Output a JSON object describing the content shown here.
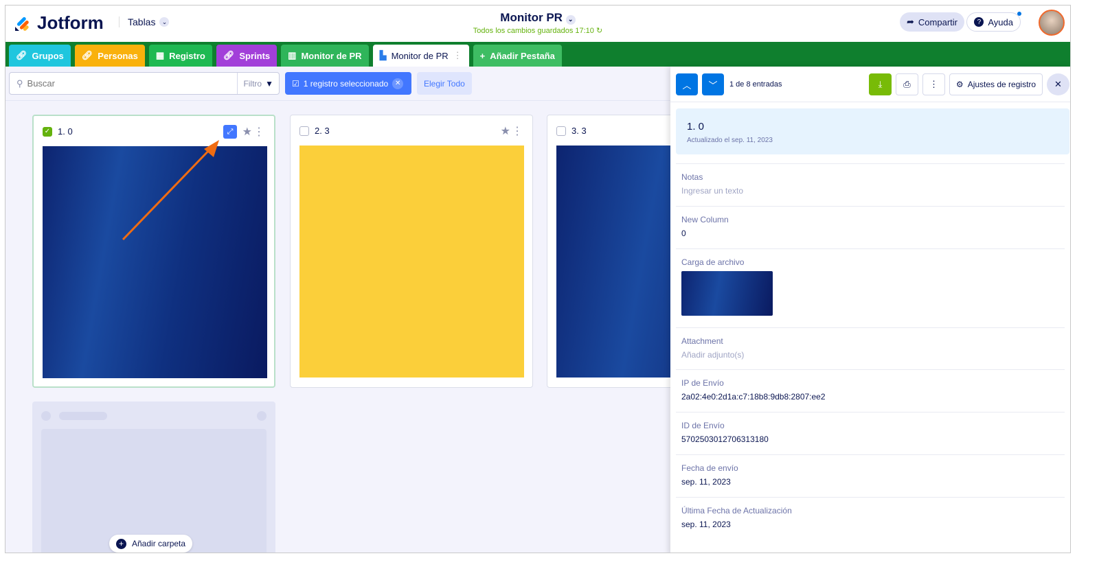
{
  "header": {
    "brand": "Jotform",
    "tables_label": "Tablas",
    "title": "Monitor PR",
    "saved_status": "Todos los cambios guardados 17:10",
    "share_label": "Compartir",
    "help_label": "Ayuda"
  },
  "tabs": [
    {
      "label": "Grupos",
      "color": "#1fc6de"
    },
    {
      "label": "Personas",
      "color": "#f9b10c"
    },
    {
      "label": "Registro",
      "color": "#1eb952"
    },
    {
      "label": "Sprints",
      "color": "#a23fd9"
    },
    {
      "label": "Monitor de PR",
      "color": "#2fb55a"
    },
    {
      "label": "Monitor de PR",
      "color": "#ffffff"
    },
    {
      "label": "Añadir Pestaña",
      "color": "#3ebd63"
    }
  ],
  "toolbar": {
    "search_placeholder": "Buscar",
    "filter_label": "Filtro",
    "selected_label": "1 registro seleccionado",
    "select_all_label": "Elegir Todo"
  },
  "cards": [
    {
      "title": "1. 0",
      "checked": true
    },
    {
      "title": "2. 3",
      "checked": false
    },
    {
      "title": "3. 3",
      "checked": false
    }
  ],
  "add_folder_label": "Añadir carpeta",
  "panel": {
    "counter": "1 de 8 entradas",
    "settings_label": "Ajustes de registro",
    "record_title": "1. 0",
    "record_updated": "Actualizado el sep. 11, 2023",
    "fields": [
      {
        "label": "Notas",
        "value": "Ingresar un texto"
      },
      {
        "label": "New Column",
        "value": "0"
      },
      {
        "label": "Carga de archivo",
        "value": ""
      },
      {
        "label": "Attachment",
        "value": "Añadir adjunto(s)"
      },
      {
        "label": "IP de Envío",
        "value": "2a02:4e0:2d1a:c7:18b8:9db8:2807:ee2"
      },
      {
        "label": "ID de Envío",
        "value": "5702503012706313180"
      },
      {
        "label": "Fecha de envío",
        "value": "sep. 11, 2023"
      },
      {
        "label": "Última Fecha de Actualización",
        "value": "sep. 11, 2023"
      }
    ]
  }
}
